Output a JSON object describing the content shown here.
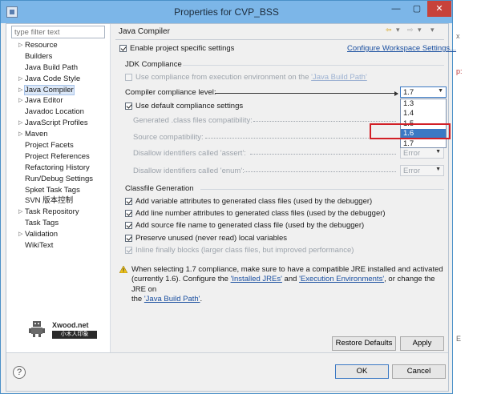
{
  "window": {
    "title": "Properties for CVP_BSS",
    "minimize": "—",
    "maximize": "▢",
    "close": "✕"
  },
  "filter": {
    "placeholder": "type filter text"
  },
  "tree": [
    {
      "label": "Resource",
      "expandable": true
    },
    {
      "label": "Builders",
      "expandable": false
    },
    {
      "label": "Java Build Path",
      "expandable": false
    },
    {
      "label": "Java Code Style",
      "expandable": true
    },
    {
      "label": "Java Compiler",
      "expandable": true,
      "selected": true
    },
    {
      "label": "Java Editor",
      "expandable": true
    },
    {
      "label": "Javadoc Location",
      "expandable": false
    },
    {
      "label": "JavaScript Profiles",
      "expandable": true
    },
    {
      "label": "Maven",
      "expandable": true
    },
    {
      "label": "Project Facets",
      "expandable": false
    },
    {
      "label": "Project References",
      "expandable": false
    },
    {
      "label": "Refactoring History",
      "expandable": false
    },
    {
      "label": "Run/Debug Settings",
      "expandable": false
    },
    {
      "label": "Spket Task Tags",
      "expandable": false
    },
    {
      "label": "SVN 版本控制",
      "expandable": false
    },
    {
      "label": "Task Repository",
      "expandable": true
    },
    {
      "label": "Task Tags",
      "expandable": false
    },
    {
      "label": "Validation",
      "expandable": true
    },
    {
      "label": "WikiText",
      "expandable": false
    }
  ],
  "watermark": {
    "name": "Xwood.net",
    "sub": "小木人印象"
  },
  "page": {
    "title": "Java Compiler",
    "enable_specific": "Enable project specific settings",
    "configure_link": "Configure Workspace Settings...",
    "jdk_group": "JDK Compliance",
    "use_env": "Use compliance from execution environment on the ",
    "use_env_link": "'Java Build Path'",
    "compliance_level_label": "Compiler compliance level:",
    "compliance_level_value": "1.7",
    "compliance_options": [
      "1.3",
      "1.4",
      "1.5",
      "1.6",
      "1.7"
    ],
    "highlighted_option": "1.6",
    "use_default": "Use default compliance settings",
    "generated_compat_label": "Generated .class files compatibility:",
    "source_compat_label": "Source compatibility:",
    "assert_label": "Disallow identifiers called 'assert':",
    "assert_value": "Error",
    "enum_label": "Disallow identifiers called 'enum':",
    "enum_value": "Error",
    "classfile_group": "Classfile Generation",
    "classfile_options": [
      {
        "label": "Add variable attributes to generated class files (used by the debugger)",
        "checked": true,
        "enabled": true
      },
      {
        "label": "Add line number attributes to generated class files (used by the debugger)",
        "checked": true,
        "enabled": true
      },
      {
        "label": "Add source file name to generated class file (used by the debugger)",
        "checked": true,
        "enabled": true
      },
      {
        "label": "Preserve unused (never read) local variables",
        "checked": true,
        "enabled": true
      },
      {
        "label": "Inline finally blocks (larger class files, but improved performance)",
        "checked": true,
        "enabled": false
      }
    ],
    "warning_line1": "When selecting 1.7 compliance, make sure to have a compatible JRE installed and activated",
    "warning_line2_a": "(currently 1.6). Configure the ",
    "warning_link_jres": "'Installed JREs'",
    "warning_and": " and ",
    "warning_link_envs": "'Execution Environments'",
    "warning_line2_b": ", or change the JRE on",
    "warning_line3_a": "the ",
    "warning_link_path": "'Java Build Path'",
    "warning_line3_b": ".",
    "restore_defaults": "Restore Defaults",
    "apply": "Apply"
  },
  "bottom": {
    "help": "?",
    "ok": "OK",
    "cancel": "Cancel"
  },
  "background": {
    "edge_x": "x",
    "edge_p": "p:",
    "edge_cut": "E"
  }
}
